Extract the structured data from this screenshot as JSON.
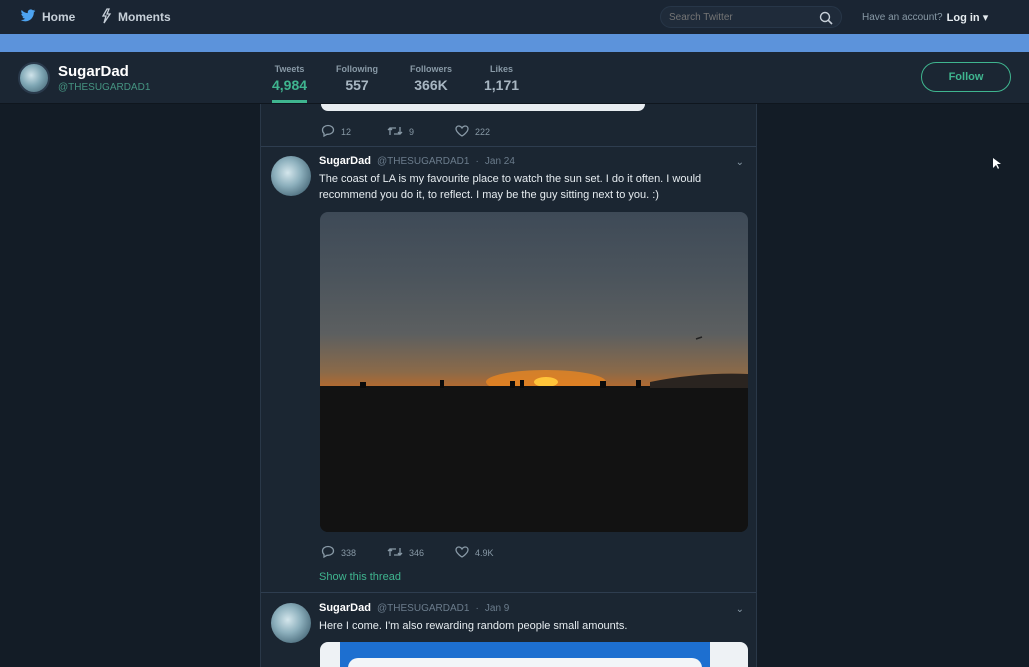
{
  "nav": {
    "home_label": "Home",
    "moments_label": "Moments",
    "search_placeholder": "Search Twitter",
    "account_prompt": "Have an account?",
    "login_label": "Log in"
  },
  "profile": {
    "name": "SugarDad",
    "handle": "@THESUGARDAD1",
    "stats": [
      {
        "label": "Tweets",
        "value": "4,984"
      },
      {
        "label": "Following",
        "value": "557"
      },
      {
        "label": "Followers",
        "value": "366K"
      },
      {
        "label": "Likes",
        "value": "1,171"
      }
    ],
    "follow_label": "Follow"
  },
  "colors": {
    "accent": "#3fb58f",
    "banner": "#5c93db",
    "background": "#131c26"
  },
  "tweets": [
    {
      "replies": "12",
      "retweets": "9",
      "likes": "222"
    },
    {
      "name": "SugarDad",
      "handle": "@THESUGARDAD1",
      "date": "Jan 24",
      "text": "The coast of LA is my favourite place to watch the sun set. I do it often. I would recommend you do it, to reflect. I may be the guy sitting next to you. :)",
      "replies": "338",
      "retweets": "346",
      "likes": "4.9K",
      "show_thread": "Show this thread"
    },
    {
      "name": "SugarDad",
      "handle": "@THESUGARDAD1",
      "date": "Jan 9",
      "text": "Here I come. I'm also rewarding random people small amounts."
    }
  ],
  "icons": [
    "twitter-bird-icon",
    "moments-icon",
    "search-icon",
    "chevron-down-icon",
    "reply-icon",
    "retweet-icon",
    "like-icon",
    "cursor-icon"
  ]
}
